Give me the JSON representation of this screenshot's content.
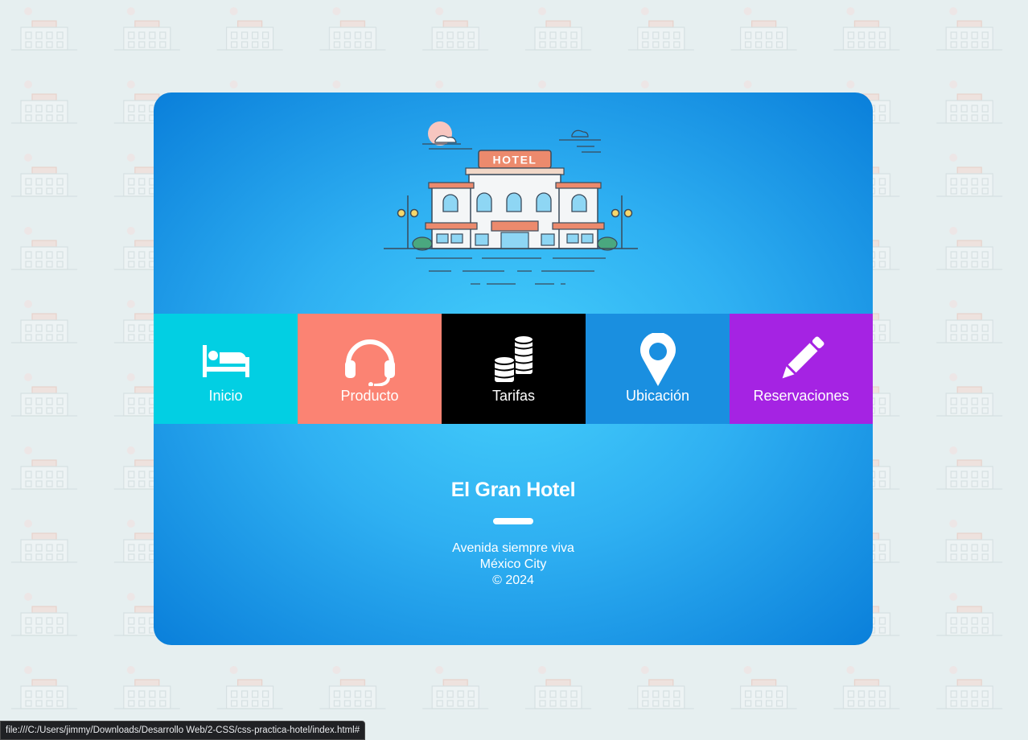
{
  "hotel_sign": "HOTEL",
  "nav": {
    "items": [
      {
        "label": "Inicio",
        "icon": "bed-icon",
        "color": "#02cfe3"
      },
      {
        "label": "Producto",
        "icon": "headset-icon",
        "color": "#fb8373"
      },
      {
        "label": "Tarifas",
        "icon": "coins-icon",
        "color": "#000000"
      },
      {
        "label": "Ubicación",
        "icon": "map-pin-icon",
        "color": "#1a8fe0"
      },
      {
        "label": "Reservaciones",
        "icon": "pencil-icon",
        "color": "#a523e3"
      }
    ]
  },
  "footer": {
    "title": "El Gran Hotel",
    "address_line1": "Avenida siempre viva",
    "address_line2": "México City",
    "copyright": "© 2024"
  },
  "status_bar": {
    "url": "file:///C:/Users/jimmy/Downloads/Desarrollo Web/2-CSS/css-practica-hotel/index.html#"
  },
  "colors": {
    "page_background": "#e6eff0",
    "card_center": "#45cffb",
    "card_edge": "#0a7fda"
  }
}
